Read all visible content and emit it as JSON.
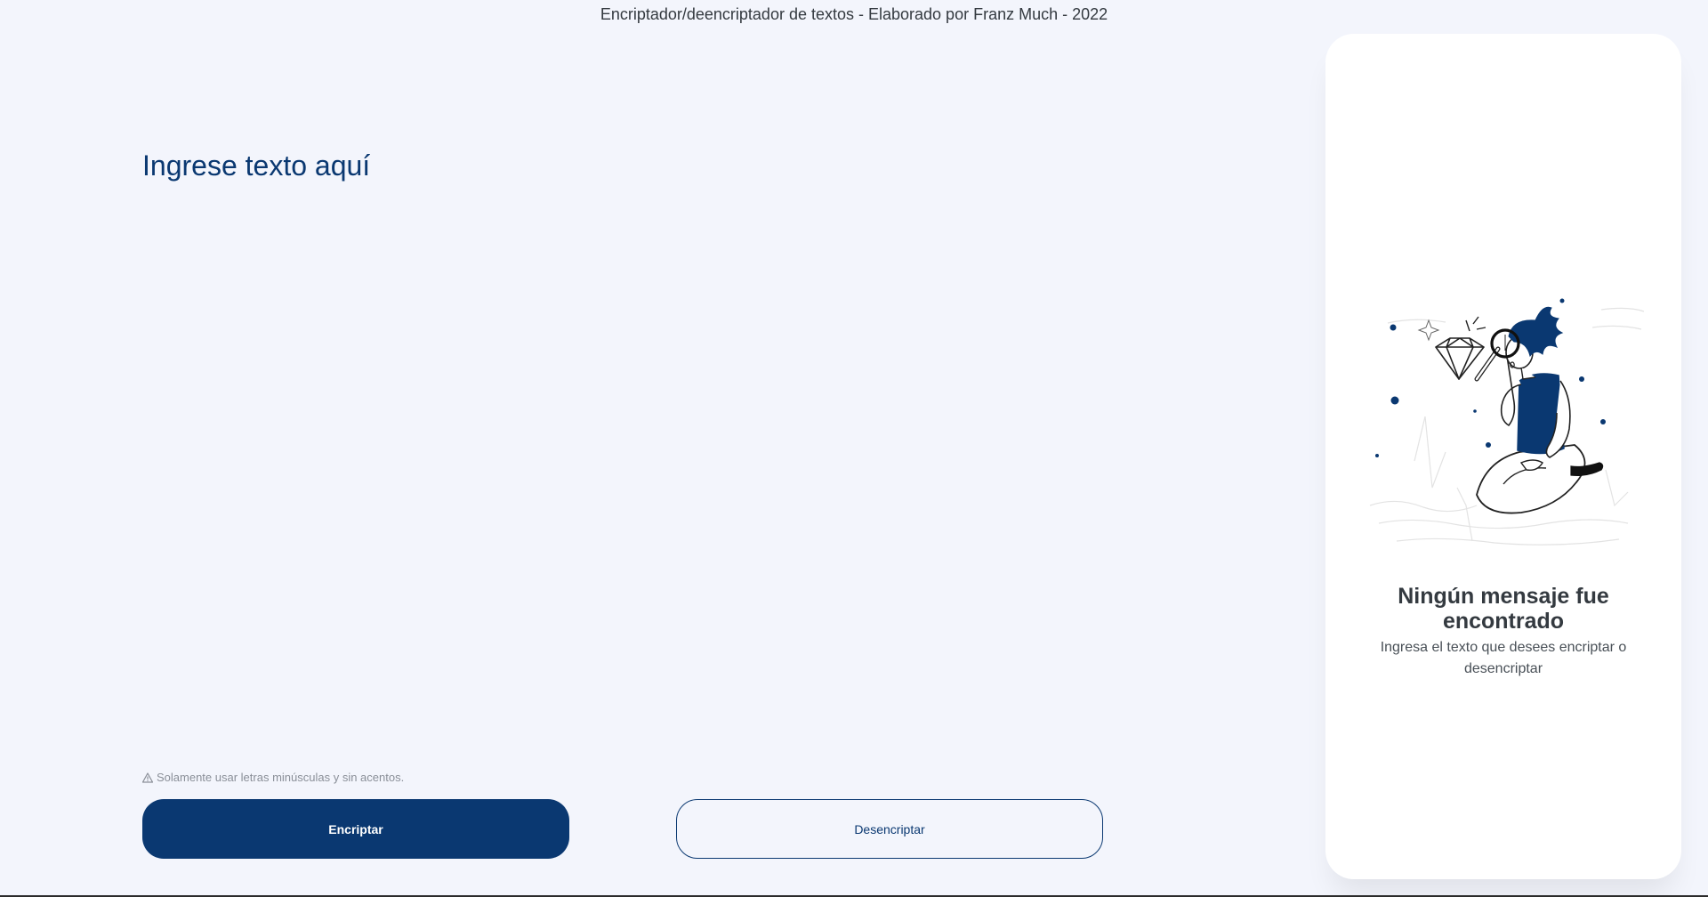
{
  "header": {
    "credit": "Encriptador/deencriptador de textos - Elaborado por Franz Much - 2022"
  },
  "input": {
    "placeholder": "Ingrese texto aquí",
    "value": ""
  },
  "warning": {
    "icon": "warning-icon",
    "text": "Solamente usar letras minúsculas y sin acentos."
  },
  "buttons": {
    "encrypt_label": "Encriptar",
    "decrypt_label": "Desencriptar"
  },
  "output": {
    "title": "Ningún mensaje fue encontrado",
    "subtitle": "Ingresa el texto que desees encriptar o desencriptar",
    "illustration": "person-with-magnifying-glass-and-diamond"
  },
  "colors": {
    "background": "#f3f5fc",
    "accent": "#0a3871",
    "card": "#ffffff",
    "text": "#343a40"
  }
}
